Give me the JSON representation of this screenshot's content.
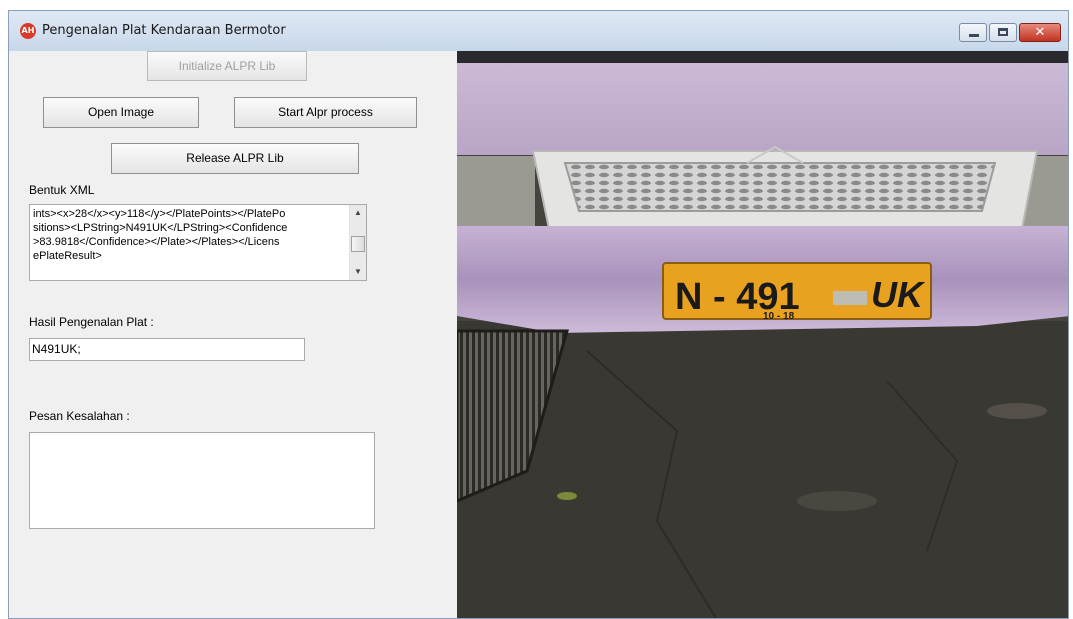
{
  "window": {
    "title": "Pengenalan Plat Kendaraan Bermotor",
    "app_icon_text": "AH",
    "close_glyph": "✕"
  },
  "buttons": {
    "initialize": "Initialize ALPR Lib",
    "open_image": "Open Image",
    "start_process": "Start Alpr process",
    "release": "Release ALPR Lib"
  },
  "xml": {
    "label": "Bentuk XML",
    "lines": [
      "ints><x>28</x><y>118</y></PlatePoints></PlatePo",
      "sitions><LPString>N491UK</LPString><Confidence",
      ">83.9818</Confidence></Plate></Plates></Licens",
      "ePlateResult>"
    ]
  },
  "result": {
    "label": "Hasil Pengenalan Plat :",
    "value": "N491UK;"
  },
  "errors": {
    "label": "Pesan Kesalahan :",
    "value": ""
  },
  "photo": {
    "plate_main": "N - 491",
    "plate_suffix": "UK",
    "plate_expiry": "10 - 18"
  },
  "colors": {
    "plate_yellow": "#e8a21f",
    "car_body": "#c9b8d2",
    "asphalt": "#3e3c37"
  }
}
